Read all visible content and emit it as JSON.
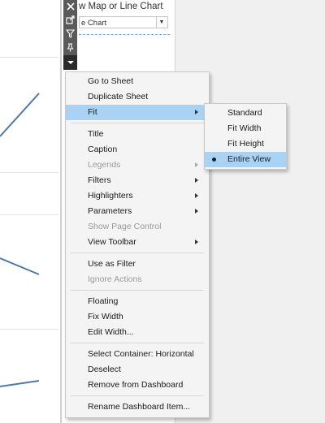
{
  "panel": {
    "title": "w Map or Line Chart",
    "select_value": "e Chart"
  },
  "toolbar": {
    "icons": [
      "close-icon",
      "open-sheet-icon",
      "filter-icon",
      "pin-icon",
      "more-options-icon"
    ]
  },
  "menu": {
    "items": [
      {
        "label": "Go to Sheet"
      },
      {
        "label": "Duplicate Sheet"
      },
      {
        "label": "Fit"
      },
      {
        "label": "Title"
      },
      {
        "label": "Caption"
      },
      {
        "label": "Legends"
      },
      {
        "label": "Filters"
      },
      {
        "label": "Highlighters"
      },
      {
        "label": "Parameters"
      },
      {
        "label": "Show Page Control"
      },
      {
        "label": "View Toolbar"
      },
      {
        "label": "Use as Filter"
      },
      {
        "label": "Ignore Actions"
      },
      {
        "label": "Floating"
      },
      {
        "label": "Fix Width"
      },
      {
        "label": "Edit Width..."
      },
      {
        "label": "Select Container: Horizontal"
      },
      {
        "label": "Deselect"
      },
      {
        "label": "Remove from Dashboard"
      },
      {
        "label": "Rename Dashboard Item..."
      }
    ]
  },
  "fit_submenu": {
    "items": [
      {
        "label": "Standard"
      },
      {
        "label": "Fit Width"
      },
      {
        "label": "Fit Height"
      },
      {
        "label": "Entire View"
      }
    ],
    "selected": "Entire View"
  },
  "colors": {
    "highlight": "#a9d3f5",
    "line": "#4e79a7",
    "toolbar": "#5a5a5a"
  }
}
